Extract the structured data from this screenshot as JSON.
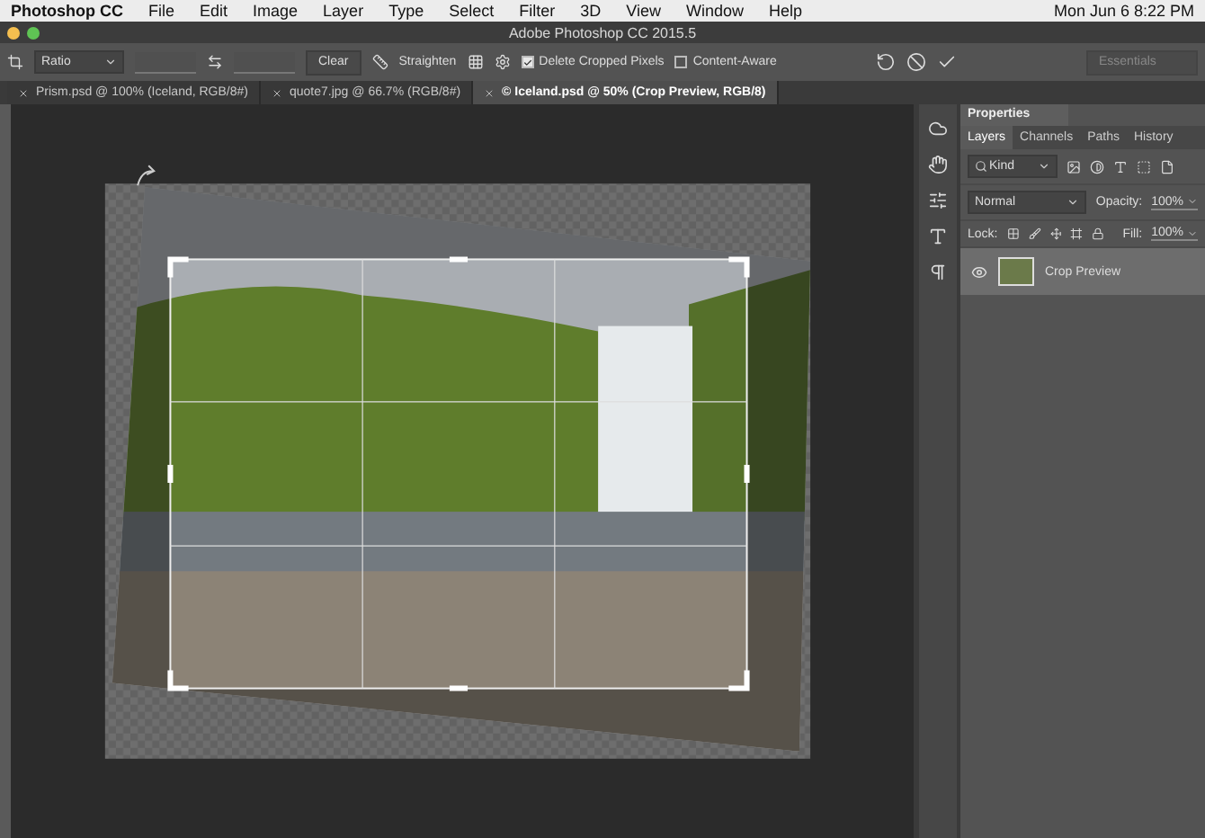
{
  "menu_bar": {
    "app": "Photoshop CC",
    "items": [
      "File",
      "Edit",
      "Image",
      "Layer",
      "Type",
      "Select",
      "Filter",
      "3D",
      "View",
      "Window",
      "Help"
    ],
    "clock": "Mon Jun 6  8:22 PM"
  },
  "window": {
    "title": "Adobe Photoshop CC 2015.5"
  },
  "options_bar": {
    "ratio": "Ratio",
    "clear": "Clear",
    "straighten": "Straighten",
    "checkboxes": [
      {
        "label": "Delete Cropped Pixels",
        "checked": true
      },
      {
        "label": "Content-Aware",
        "checked": false
      }
    ],
    "workspace": "Essentials"
  },
  "tabs": [
    {
      "label": "Prism.psd @ 100% (Iceland, RGB/8#)",
      "selected": false
    },
    {
      "label": "quote7.jpg @ 66.7% (RGB/8#)",
      "selected": false
    },
    {
      "label": "© Iceland.psd @ 50% (Crop Preview, RGB/8)",
      "selected": true
    }
  ],
  "panel": {
    "title": "Properties",
    "tabs": [
      {
        "label": "Layers",
        "selected": true
      },
      {
        "label": "Channels",
        "selected": false
      },
      {
        "label": "Paths",
        "selected": false
      },
      {
        "label": "History",
        "selected": false
      }
    ],
    "filter": "Kind",
    "blend_mode": "Normal",
    "opacity_label": "Opacity:",
    "opacity": "100%",
    "lock_label": "Lock:",
    "fill_label": "Fill:",
    "fill": "100%",
    "layers": [
      {
        "name": "Crop Preview",
        "visible": true,
        "selected": true
      }
    ]
  }
}
